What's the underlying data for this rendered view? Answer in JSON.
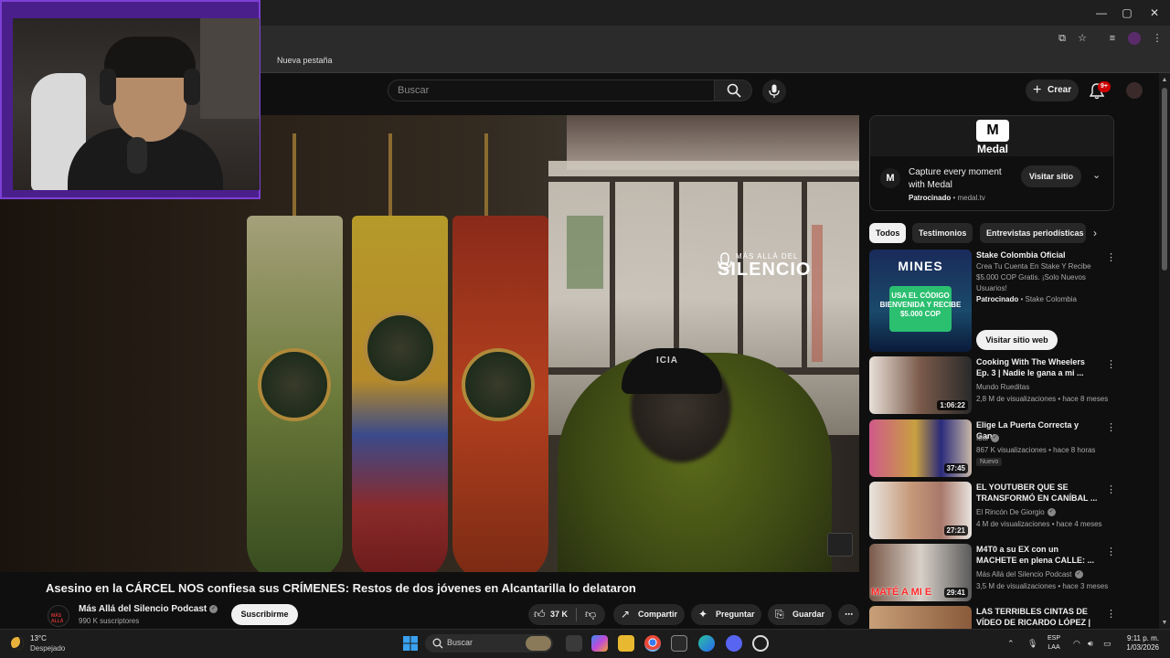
{
  "browser": {
    "bookmark": "Nueva pestaña",
    "window_controls": [
      "—",
      "▢",
      "✕"
    ]
  },
  "header": {
    "search_placeholder": "Buscar",
    "create_label": "Crear",
    "notif_badge": "9+"
  },
  "video": {
    "watermark_small": "MÁS ALLÁ DEL",
    "watermark_big": "SILENCIO",
    "cap_text": "ICIA",
    "title": "Asesino en la CÁRCEL NOS confiesa sus CRÍMENES: Restos de dos jóvenes en Alcantarilla lo delataron",
    "channel": "Más Allá del Silencio Podcast",
    "channel_avatar_text": "MÁS ALLÁ",
    "subscribers": "990 K suscriptores",
    "subscribe_label": "Suscribirme",
    "likes": "37 K",
    "share_label": "Compartir",
    "ask_label": "Preguntar",
    "save_label": "Guardar"
  },
  "ad": {
    "brand": "Medal",
    "headline": "Capture every moment with Medal",
    "sponsored": "Patrocinado",
    "domain": "medal.tv",
    "visit_label": "Visitar sitio"
  },
  "chips": [
    "Todos",
    "Testimonios",
    "Entrevistas periodísticas"
  ],
  "sidebar": {
    "promo": {
      "title": "Stake Colombia Oficial",
      "desc": "Crea Tu Cuenta En Stake Y Recibe $5.000 COP Gratis. ¡Solo Nuevos Usuarios!",
      "sponsored": "Patrocinado",
      "advertiser": "Stake Colombia",
      "visit_label": "Visitar sitio web",
      "thumb_line1": "MINES",
      "thumb_line2": "USA EL CÓDIGO BIENVENIDA Y RECIBE $5.000 COP"
    },
    "videos": [
      {
        "title": "Cooking With The Wheelers Ep. 3 | Nadie le gana a mi ...",
        "channel": "Mundo Rueditas",
        "meta": "2,8 M de visualizaciones • hace 8 meses",
        "duration": "1:06:22",
        "verified": false,
        "badge": ""
      },
      {
        "title": "Elige La Puerta Correcta y Gana",
        "channel": "Ibai",
        "meta": "867 K visualizaciones • hace 8 horas",
        "duration": "37:45",
        "verified": true,
        "badge": "Nuevo"
      },
      {
        "title": "EL YOUTUBER QUE SE TRANSFORMÓ EN CANÍBAL ...",
        "channel": "El Rincón De Giorgio",
        "meta": "4 M de visualizaciones • hace 4 meses",
        "duration": "27:21",
        "verified": true,
        "badge": ""
      },
      {
        "title": "M4T0 a su EX con un MACHETE en plena CALLE: ...",
        "channel": "Más Allá del Silencio Podcast",
        "meta": "3,5 M de visualizaciones • hace 3 meses",
        "duration": "29:41",
        "verified": true,
        "badge": "",
        "thumb_text": "MATÉ A MI E"
      },
      {
        "title": "LAS TERRIBLES CINTAS DE VÍDEO DE RICARDO LÓPEZ | El...",
        "channel": "",
        "meta": "",
        "duration": "",
        "verified": false,
        "badge": ""
      }
    ]
  },
  "taskbar": {
    "temp": "13°C",
    "weather": "Despejado",
    "search": "Buscar",
    "lang1": "ESP",
    "lang2": "LAA",
    "time": "9:11 p. m.",
    "date": "1/03/2026"
  }
}
